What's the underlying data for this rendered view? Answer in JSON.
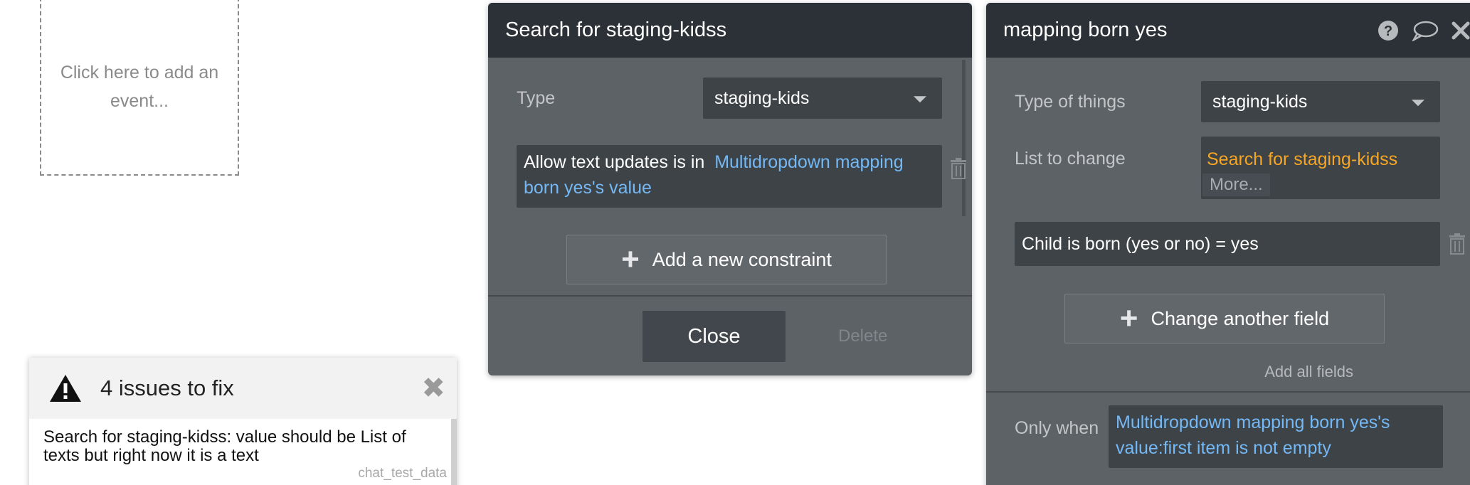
{
  "event_placeholder": {
    "text": "Click here to add an event..."
  },
  "issues_panel": {
    "title": "4 issues to fix",
    "issue_text": "Search for staging-kidss: value should be List of texts but right now it is a text",
    "issue_source": "chat_test_data"
  },
  "search_panel": {
    "title": "Search for staging-kidss",
    "type_label": "Type",
    "type_value": "staging-kids",
    "constraint_prefix": "Allow text updates is in",
    "constraint_value": "Multidropdown mapping born yes's value",
    "add_constraint_label": "Add a new constraint",
    "close_label": "Close",
    "delete_label": "Delete"
  },
  "mapping_panel": {
    "title": "mapping born yes",
    "type_label": "Type of things",
    "type_value": "staging-kids",
    "list_label": "List to change",
    "list_value": "Search for staging-kidss",
    "more_label": "More...",
    "field_row": "Child is born (yes or no)  =  yes",
    "change_field_label": "Change another field",
    "add_all_label": "Add all fields",
    "only_when_label": "Only when",
    "only_when_value": "Multidropdown mapping born yes's value:first item is not empty"
  },
  "colors": {
    "panel_bg": "#5d6266",
    "header_bg": "#2b3136",
    "dynamic_blue": "#74b8f5",
    "dynamic_orange": "#f6a623"
  }
}
